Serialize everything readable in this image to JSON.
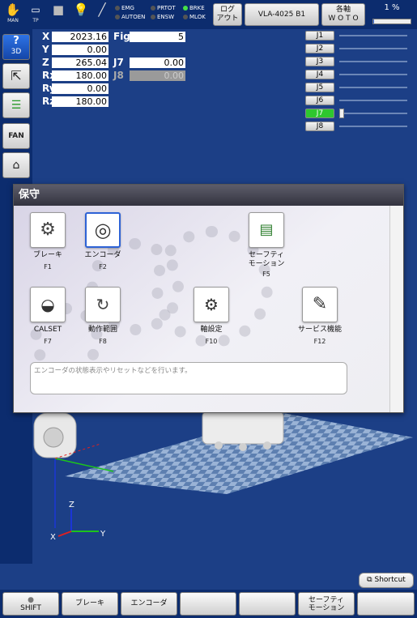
{
  "topbar": {
    "mode_label": "MAN",
    "tp_label": "TP",
    "status": {
      "emg": "EMG",
      "protect": "PRTOT",
      "brake": "BRKE",
      "autoen": "AUTOEN",
      "ensw": "ENSW",
      "mlok": "MLOK"
    },
    "logout": [
      "ログ",
      "アウト"
    ],
    "model": "VLA-4025 B1",
    "axis_mode": [
      "各軸",
      "W O T O"
    ],
    "speed": "1 %",
    "speed_percent": 1
  },
  "left": {
    "help_label": "3D",
    "fan_label": "FAN"
  },
  "coords": {
    "x_label": "X",
    "x": "2023.16",
    "y_label": "Y",
    "y": "0.00",
    "z_label": "Z",
    "z": "265.04",
    "rx_label": "Rx",
    "rx": "180.00",
    "ry_label": "Ry",
    "ry": "0.00",
    "rz_label": "Rz",
    "rz": "180.00",
    "fig_label": "Fig",
    "fig": "5",
    "j7_label": "J7",
    "j7": "0.00",
    "j8_label": "J8",
    "j8": "0.00"
  },
  "joints": [
    {
      "label": "J1",
      "active": false,
      "level": null
    },
    {
      "label": "J2",
      "active": false,
      "level": null
    },
    {
      "label": "J3",
      "active": false,
      "level": null
    },
    {
      "label": "J4",
      "active": false,
      "level": null
    },
    {
      "label": "J5",
      "active": false,
      "level": null
    },
    {
      "label": "J6",
      "active": false,
      "level": null
    },
    {
      "label": "J7",
      "active": true,
      "level": 0
    },
    {
      "label": "J8",
      "active": false,
      "level": null
    }
  ],
  "dialog": {
    "title": "保守",
    "items": [
      {
        "name": "ブレーキ",
        "key": "F1",
        "icon": "brake-icon"
      },
      {
        "name": "エンコーダ",
        "key": "F2",
        "icon": "encoder-icon"
      },
      {
        "name": "セーフティ\nモーション",
        "key": "F5",
        "icon": "safety-motion-icon"
      },
      {
        "name": "CALSET",
        "key": "F7",
        "icon": "calset-icon"
      },
      {
        "name": "動作範囲",
        "key": "F8",
        "icon": "motion-range-icon"
      },
      {
        "name": "軸設定",
        "key": "F10",
        "icon": "axis-setting-icon"
      },
      {
        "name": "サービス機能",
        "key": "F12",
        "icon": "service-wrench-icon"
      }
    ],
    "description": "エンコーダの状態表示やリセットなどを行います。"
  },
  "scene": {
    "axis_x": "X",
    "axis_y": "Y",
    "axis_z": "Z"
  },
  "shortcut_label": "Shortcut",
  "fkeys": [
    {
      "top": "●",
      "label": "SHIFT"
    },
    {
      "top": "",
      "label": "ブレーキ"
    },
    {
      "top": "",
      "label": "エンコーダ"
    },
    {
      "top": "",
      "label": ""
    },
    {
      "top": "",
      "label": ""
    },
    {
      "top": "セーフティ",
      "label": "モーション"
    },
    {
      "top": "",
      "label": ""
    }
  ]
}
